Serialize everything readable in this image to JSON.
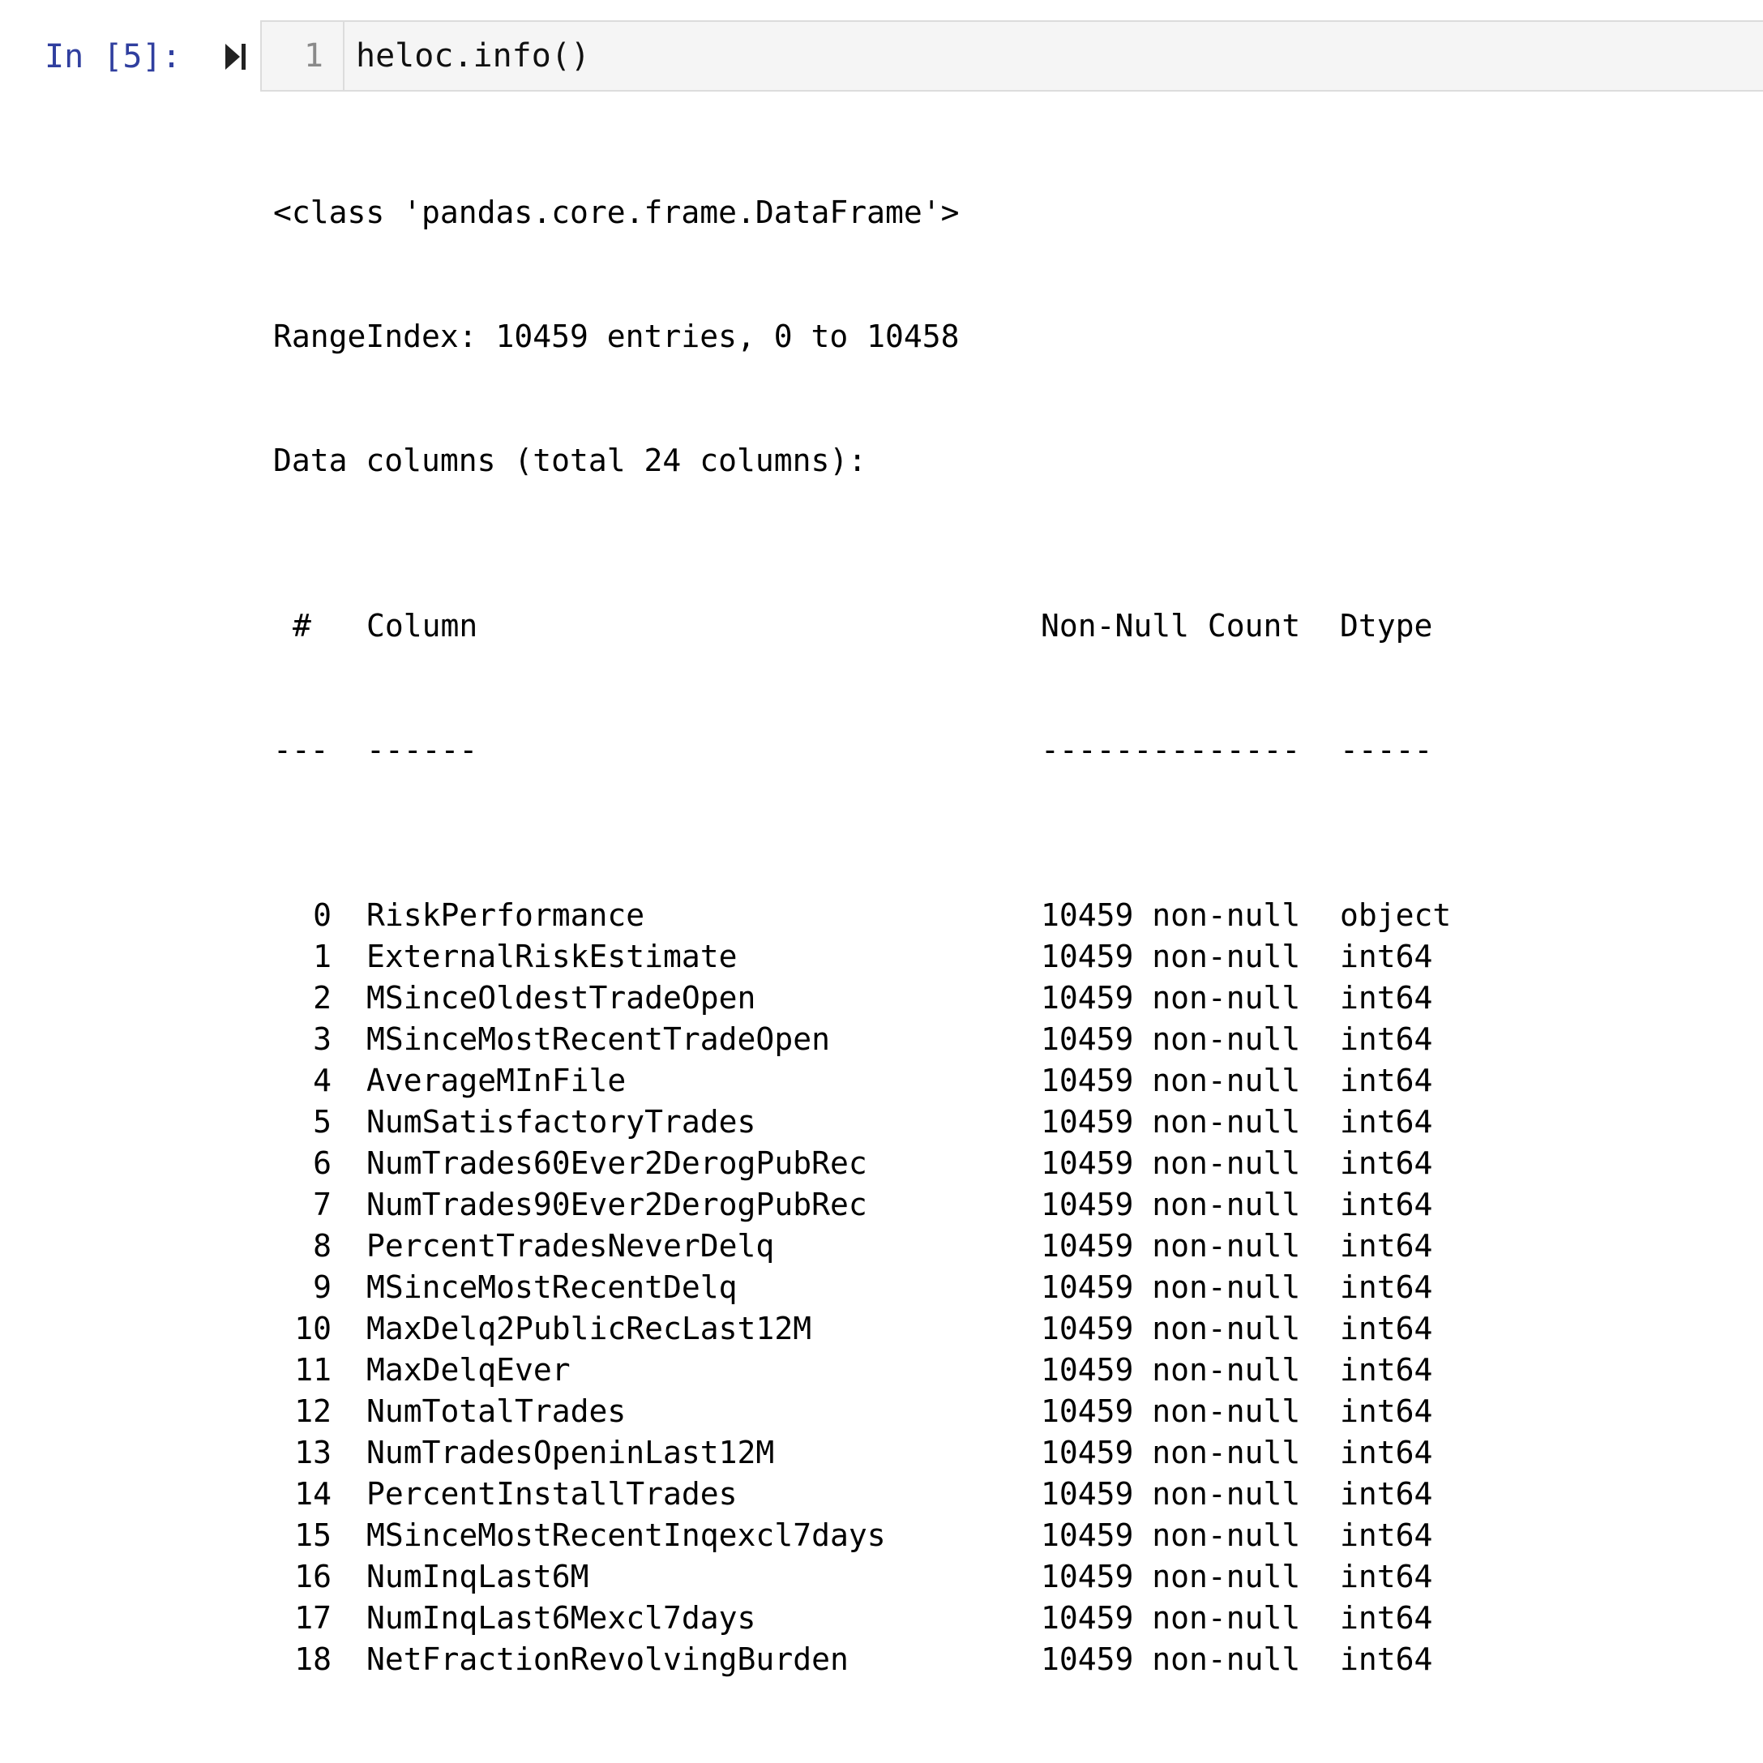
{
  "cell": {
    "prompt": "In [5]:",
    "line_number": "1",
    "code": "heloc.info()"
  },
  "output": {
    "class_line": "<class 'pandas.core.frame.DataFrame'>",
    "range_index": "RangeIndex: 10459 entries, 0 to 10458",
    "data_columns": "Data columns (total 24 columns):",
    "header": {
      "idx": "#",
      "column": "Column",
      "non_null": "Non-Null Count",
      "dtype": "Dtype"
    },
    "separator": {
      "idx": "---",
      "column": "------",
      "non_null": "--------------",
      "dtype": "-----"
    },
    "rows": [
      {
        "idx": "0",
        "column": "RiskPerformance",
        "non_null": "10459 non-null",
        "dtype": "object"
      },
      {
        "idx": "1",
        "column": "ExternalRiskEstimate",
        "non_null": "10459 non-null",
        "dtype": "int64"
      },
      {
        "idx": "2",
        "column": "MSinceOldestTradeOpen",
        "non_null": "10459 non-null",
        "dtype": "int64"
      },
      {
        "idx": "3",
        "column": "MSinceMostRecentTradeOpen",
        "non_null": "10459 non-null",
        "dtype": "int64"
      },
      {
        "idx": "4",
        "column": "AverageMInFile",
        "non_null": "10459 non-null",
        "dtype": "int64"
      },
      {
        "idx": "5",
        "column": "NumSatisfactoryTrades",
        "non_null": "10459 non-null",
        "dtype": "int64"
      },
      {
        "idx": "6",
        "column": "NumTrades60Ever2DerogPubRec",
        "non_null": "10459 non-null",
        "dtype": "int64"
      },
      {
        "idx": "7",
        "column": "NumTrades90Ever2DerogPubRec",
        "non_null": "10459 non-null",
        "dtype": "int64"
      },
      {
        "idx": "8",
        "column": "PercentTradesNeverDelq",
        "non_null": "10459 non-null",
        "dtype": "int64"
      },
      {
        "idx": "9",
        "column": "MSinceMostRecentDelq",
        "non_null": "10459 non-null",
        "dtype": "int64"
      },
      {
        "idx": "10",
        "column": "MaxDelq2PublicRecLast12M",
        "non_null": "10459 non-null",
        "dtype": "int64"
      },
      {
        "idx": "11",
        "column": "MaxDelqEver",
        "non_null": "10459 non-null",
        "dtype": "int64"
      },
      {
        "idx": "12",
        "column": "NumTotalTrades",
        "non_null": "10459 non-null",
        "dtype": "int64"
      },
      {
        "idx": "13",
        "column": "NumTradesOpeninLast12M",
        "non_null": "10459 non-null",
        "dtype": "int64"
      },
      {
        "idx": "14",
        "column": "PercentInstallTrades",
        "non_null": "10459 non-null",
        "dtype": "int64"
      },
      {
        "idx": "15",
        "column": "MSinceMostRecentInqexcl7days",
        "non_null": "10459 non-null",
        "dtype": "int64"
      },
      {
        "idx": "16",
        "column": "NumInqLast6M",
        "non_null": "10459 non-null",
        "dtype": "int64"
      },
      {
        "idx": "17",
        "column": "NumInqLast6Mexcl7days",
        "non_null": "10459 non-null",
        "dtype": "int64"
      },
      {
        "idx": "18",
        "column": "NetFractionRevolvingBurden",
        "non_null": "10459 non-null",
        "dtype": "int64"
      }
    ]
  }
}
